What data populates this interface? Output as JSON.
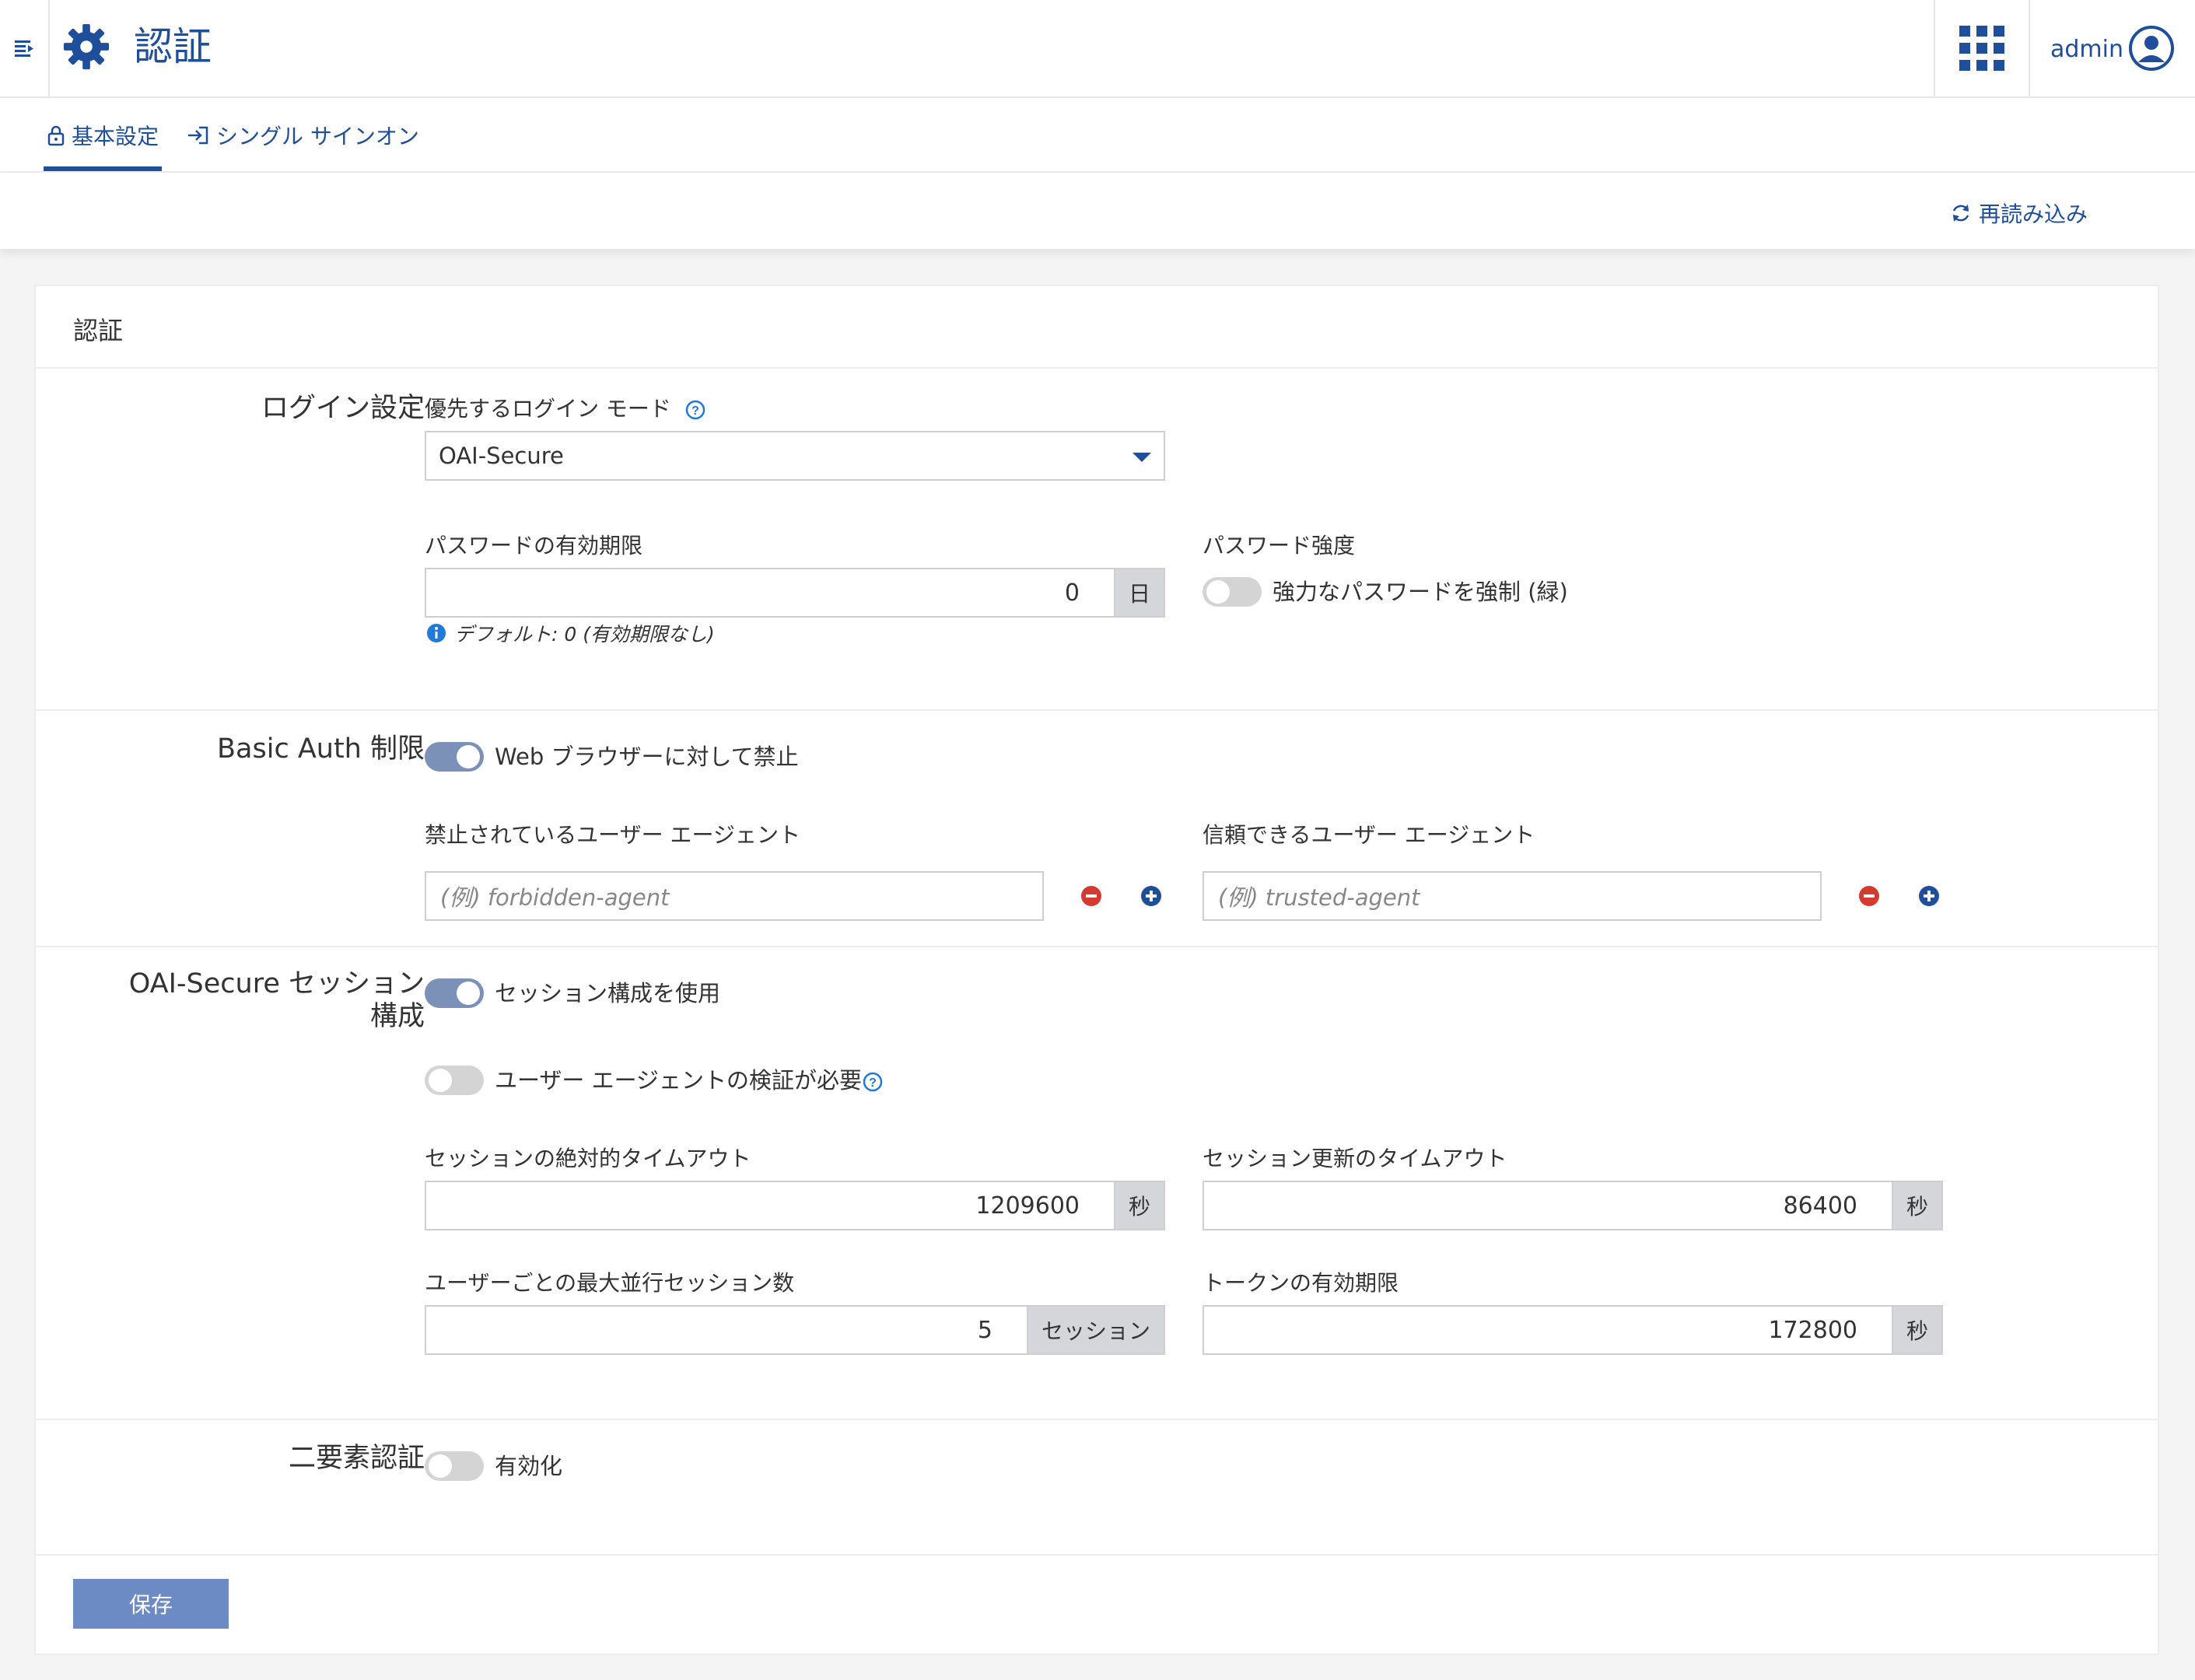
{
  "header": {
    "title": "認証",
    "user": "admin"
  },
  "tabs": [
    {
      "label": "基本設定"
    },
    {
      "label": "シングル サインオン"
    }
  ],
  "toolbar": {
    "reload_label": "再読み込み"
  },
  "card": {
    "title": "認証"
  },
  "login": {
    "section_label": "ログイン設定",
    "mode_label": "優先するログイン モード",
    "mode_value": "OAI-Secure",
    "pw_expiry_label": "パスワードの有効期限",
    "pw_expiry_value": "0",
    "pw_expiry_unit": "日",
    "pw_expiry_hint": "デフォルト: 0 (有効期限なし)",
    "pw_strength_label": "パスワード強度",
    "pw_strength_toggle": "強力なパスワードを強制 (緑)"
  },
  "basic_auth": {
    "section_label": "Basic Auth 制限",
    "toggle_label": "Web ブラウザーに対して禁止",
    "forbidden_label": "禁止されているユーザー エージェント",
    "forbidden_placeholder": "(例) forbidden-agent",
    "trusted_label": "信頼できるユーザー エージェント",
    "trusted_placeholder": "(例) trusted-agent"
  },
  "session": {
    "section_label_1": "OAI-Secure セッション",
    "section_label_2": "構成",
    "use_config_label": "セッション構成を使用",
    "ua_verify_label": "ユーザー エージェントの検証が必要",
    "abs_timeout_label": "セッションの絶対的タイムアウト",
    "abs_timeout_value": "1209600",
    "abs_timeout_unit": "秒",
    "refresh_timeout_label": "セッション更新のタイムアウト",
    "refresh_timeout_value": "86400",
    "refresh_timeout_unit": "秒",
    "max_sessions_label": "ユーザーごとの最大並行セッション数",
    "max_sessions_value": "5",
    "max_sessions_unit": "セッション",
    "token_expiry_label": "トークンの有効期限",
    "token_expiry_value": "172800",
    "token_expiry_unit": "秒"
  },
  "two_factor": {
    "section_label": "二要素認証",
    "toggle_label": "有効化"
  },
  "save_label": "保存",
  "colors": {
    "accent": "#1f4e9a",
    "toggle_on": "#7b91b7",
    "toggle_off": "#d4d4d4",
    "remove": "#d43a2f",
    "save_button": "#6c8bc4"
  }
}
